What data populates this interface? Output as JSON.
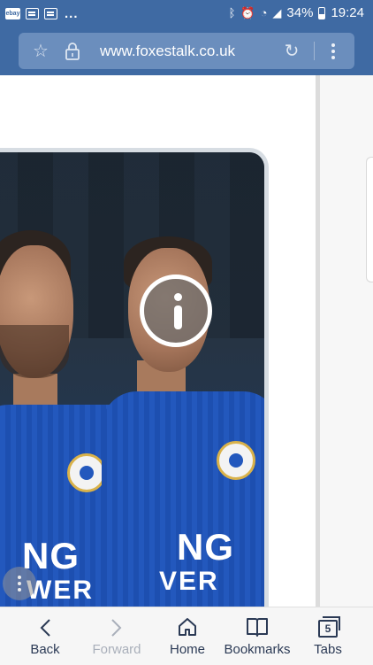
{
  "status_bar": {
    "notification_icons": [
      "ebay-notification-icon",
      "message-notification-icon",
      "gallery-notification-icon"
    ],
    "notification_overflow": "...",
    "status_icons": [
      "bluetooth-icon",
      "alarm-icon",
      "wifi-icon",
      "signal-icon"
    ],
    "battery_percent": "34%",
    "time": "19:24"
  },
  "browser": {
    "url": "www.foxestalk.co.uk",
    "icons": [
      "star-icon",
      "lock-icon",
      "refresh-icon",
      "more-menu-icon"
    ]
  },
  "content": {
    "image_overlay_icon": "info-icon",
    "sponsor_line1_left": "NG",
    "sponsor_line2_left": "WER",
    "sponsor_line1_right": "NG",
    "sponsor_line2_right": "VER"
  },
  "bottom_nav": {
    "items": [
      {
        "label": "Back",
        "icon": "back-arrow-icon",
        "enabled": true
      },
      {
        "label": "Forward",
        "icon": "forward-arrow-icon",
        "enabled": false
      },
      {
        "label": "Home",
        "icon": "home-icon",
        "enabled": true
      },
      {
        "label": "Bookmarks",
        "icon": "bookmarks-icon",
        "enabled": true
      },
      {
        "label": "Tabs",
        "icon": "tabs-icon",
        "enabled": true,
        "count": "5"
      }
    ]
  },
  "colors": {
    "toolbar_blue": "#3f6aa3",
    "urlbar_blue": "#6b8ebd",
    "nav_text": "#2b3a55"
  }
}
